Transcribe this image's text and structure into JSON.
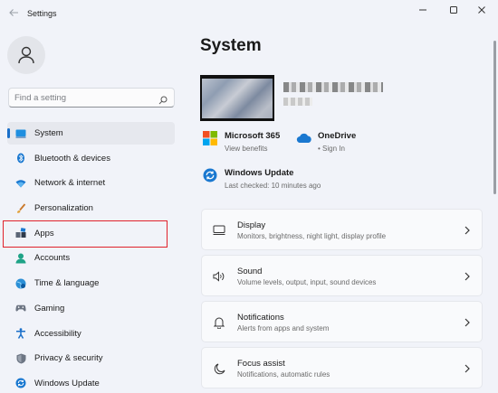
{
  "window": {
    "title": "Settings"
  },
  "search": {
    "placeholder": "Find a setting"
  },
  "sidebar": {
    "items": [
      {
        "label": "System",
        "icon": "monitor-icon",
        "selected": true
      },
      {
        "label": "Bluetooth & devices",
        "icon": "bluetooth-icon"
      },
      {
        "label": "Network & internet",
        "icon": "wifi-icon"
      },
      {
        "label": "Personalization",
        "icon": "brush-icon"
      },
      {
        "label": "Apps",
        "icon": "apps-icon",
        "highlighted": true
      },
      {
        "label": "Accounts",
        "icon": "person-icon"
      },
      {
        "label": "Time & language",
        "icon": "globe-clock-icon"
      },
      {
        "label": "Gaming",
        "icon": "controller-icon"
      },
      {
        "label": "Accessibility",
        "icon": "accessibility-icon"
      },
      {
        "label": "Privacy & security",
        "icon": "shield-icon"
      },
      {
        "label": "Windows Update",
        "icon": "sync-icon"
      }
    ]
  },
  "main": {
    "title": "System",
    "tiles": {
      "microsoft365": {
        "title": "Microsoft 365",
        "subtitle": "View benefits"
      },
      "onedrive": {
        "title": "OneDrive",
        "subtitle": "• Sign In"
      },
      "windows_update": {
        "title": "Windows Update",
        "subtitle": "Last checked: 10 minutes ago"
      }
    },
    "cards": [
      {
        "title": "Display",
        "subtitle": "Monitors, brightness, night light, display profile",
        "icon": "display-icon"
      },
      {
        "title": "Sound",
        "subtitle": "Volume levels, output, input, sound devices",
        "icon": "speaker-icon"
      },
      {
        "title": "Notifications",
        "subtitle": "Alerts from apps and system",
        "icon": "bell-icon"
      },
      {
        "title": "Focus assist",
        "subtitle": "Notifications, automatic rules",
        "icon": "moon-icon"
      }
    ]
  },
  "colors": {
    "accent": "#1a6fc9",
    "highlight_box": "#e0222b",
    "background": "#f1f3f9"
  }
}
